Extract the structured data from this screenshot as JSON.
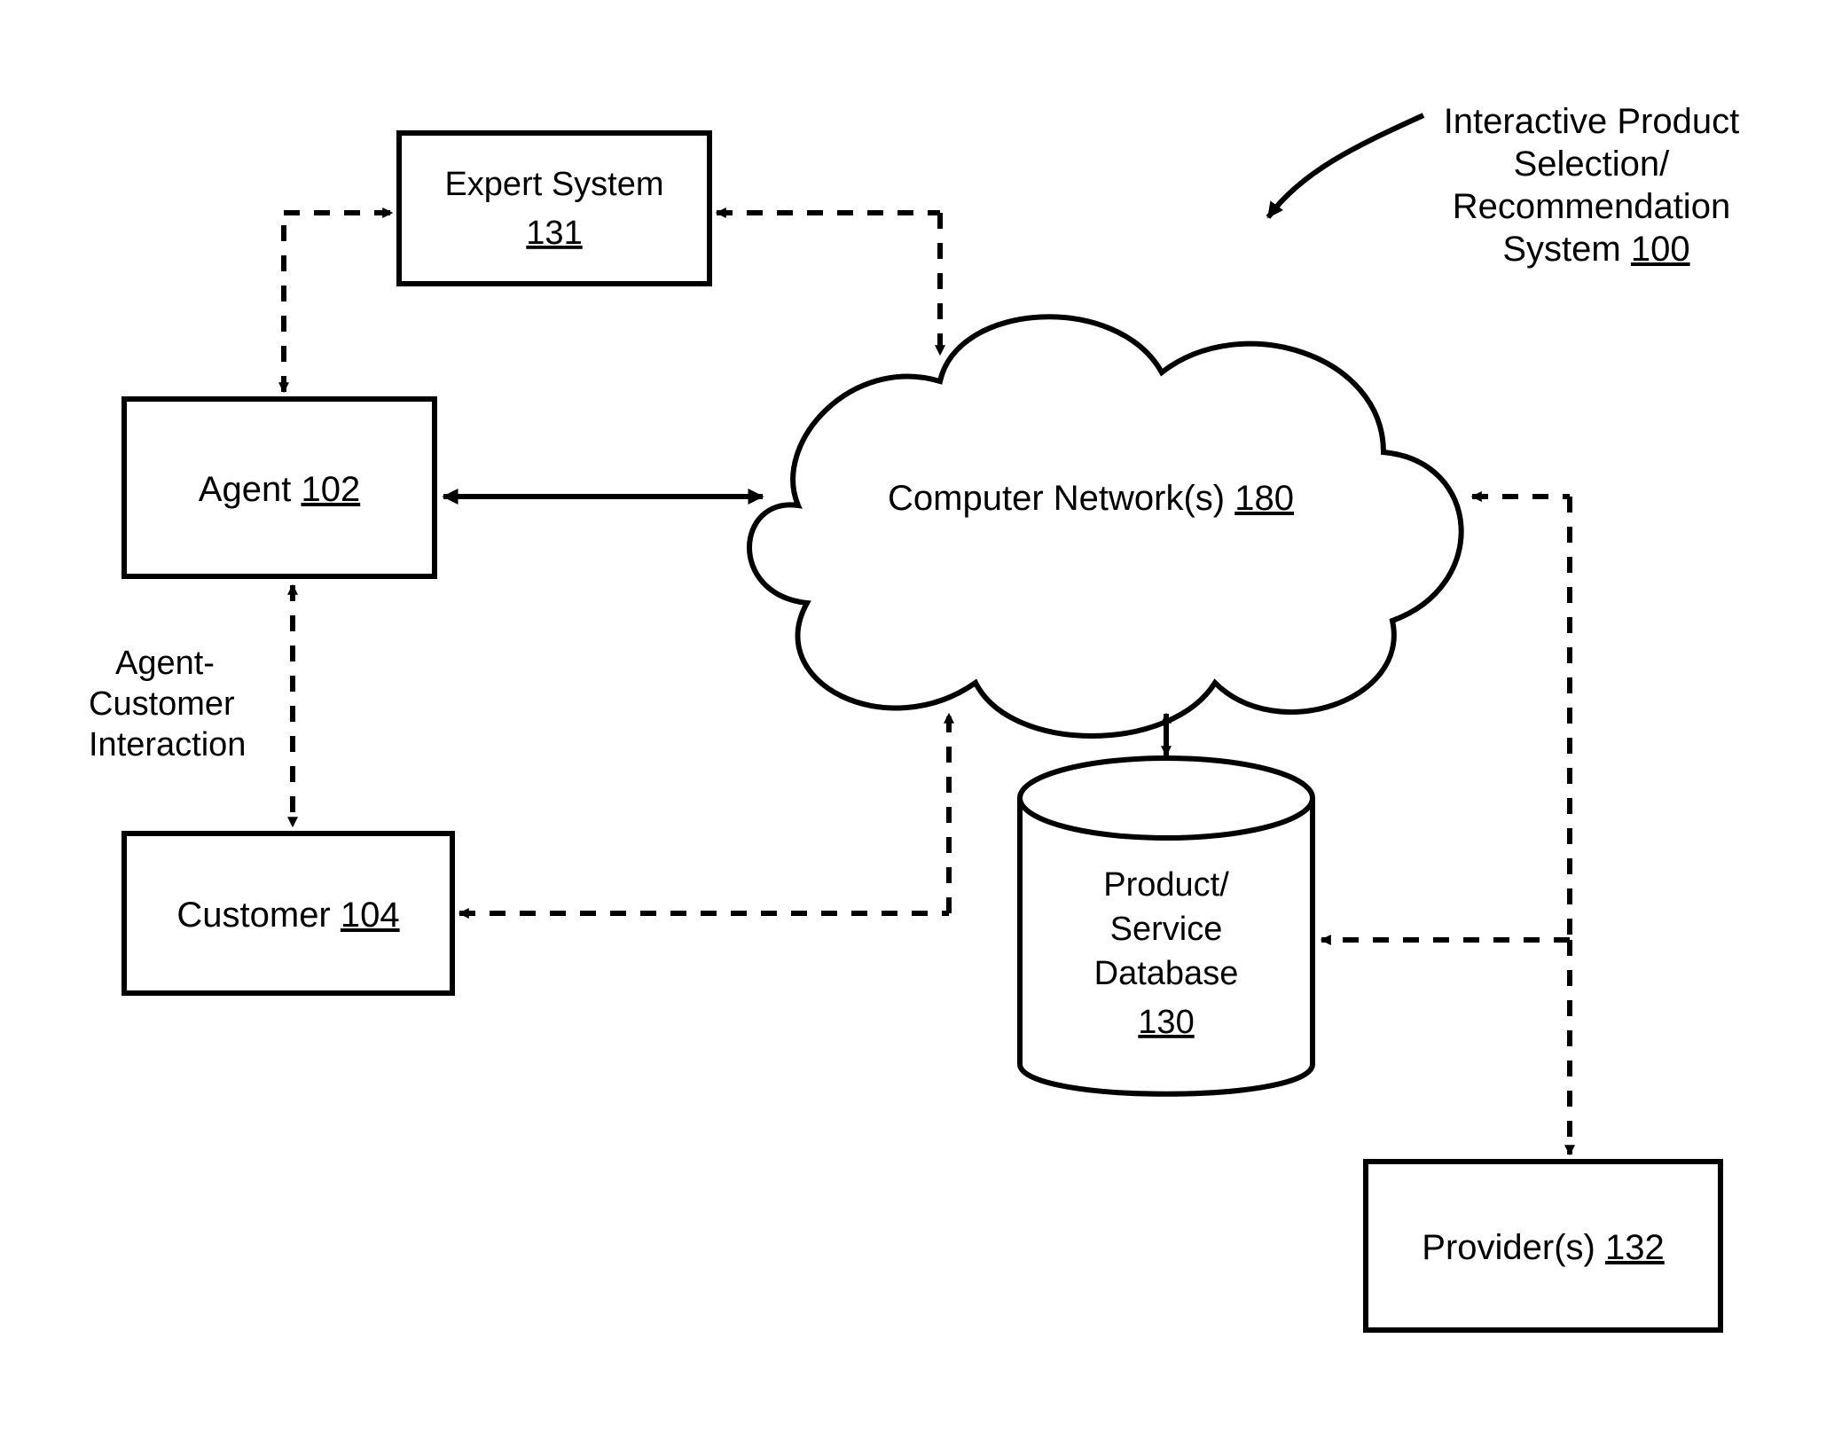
{
  "title": {
    "line1": "Interactive Product",
    "line2": "Selection/",
    "line3": "Recommendation",
    "line4_prefix": "System ",
    "line4_ref": "100"
  },
  "nodes": {
    "expert": {
      "label": "Expert System",
      "ref": "131"
    },
    "agent": {
      "label_prefix": "Agent ",
      "ref": "102"
    },
    "customer": {
      "label_prefix": "Customer ",
      "ref": "104"
    },
    "network": {
      "label_prefix": "Computer Network(s) ",
      "ref": "180"
    },
    "database": {
      "line1": "Product/",
      "line2": "Service",
      "line3": "Database",
      "ref": "130"
    },
    "provider": {
      "label_prefix": "Provider(s) ",
      "ref": "132"
    }
  },
  "edge_label": {
    "line1": "Agent-",
    "line2": "Customer",
    "line3": "Interaction"
  }
}
